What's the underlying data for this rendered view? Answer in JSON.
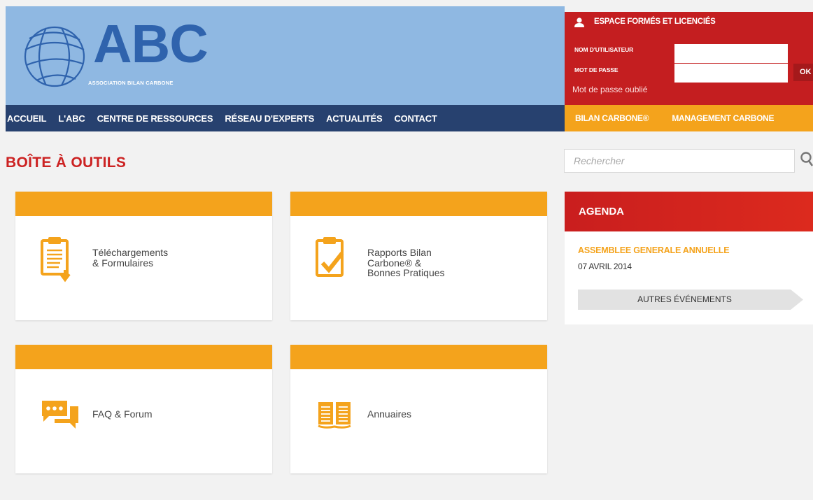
{
  "header": {
    "logo_big": "ABC",
    "logo_sub": "ASSOCIATION BILAN CARBONE"
  },
  "login": {
    "title": "ESPACE FORMÉS ET LICENCIÉS",
    "username_label": "NOM D'UTILISATEUR",
    "password_label": "MOT DE PASSE",
    "username_value": "",
    "password_value": "",
    "ok_label": "OK",
    "forgot_label": "Mot de passe oublié"
  },
  "nav": {
    "items": [
      "ACCUEIL",
      "L'ABC",
      "CENTRE DE RESSOURCES",
      "RÉSEAU D'EXPERTS",
      "ACTUALITÉS",
      "CONTACT"
    ]
  },
  "subnav": {
    "items": [
      "BILAN CARBONE®",
      "MANAGEMENT CARBONE"
    ]
  },
  "main": {
    "title": "BOÎTE À OUTILS",
    "cards": [
      {
        "label": "Téléchargements\n& Formulaires",
        "icon": "clipboard-download-icon"
      },
      {
        "label": "Rapports Bilan\nCarbone® &\nBonnes Pratiques",
        "icon": "clipboard-check-icon"
      },
      {
        "label": "FAQ & Forum",
        "icon": "chat-bubbles-icon"
      },
      {
        "label": "Annuaires",
        "icon": "open-book-icon"
      }
    ]
  },
  "sidebar": {
    "search_placeholder": "Rechercher",
    "agenda_title": "AGENDA",
    "event_title": "ASSEMBLEE GENERALE ANNUELLE",
    "event_date": "07 AVRIL 2014",
    "more_label": "AUTRES ÉVÉNEMENTS"
  },
  "colors": {
    "header_blue": "#8fb8e2",
    "logo_blue": "#2f63ad",
    "login_red": "#c41e20",
    "nav_navy": "#27416f",
    "accent_orange": "#f4a31c",
    "title_red": "#cc2222"
  }
}
